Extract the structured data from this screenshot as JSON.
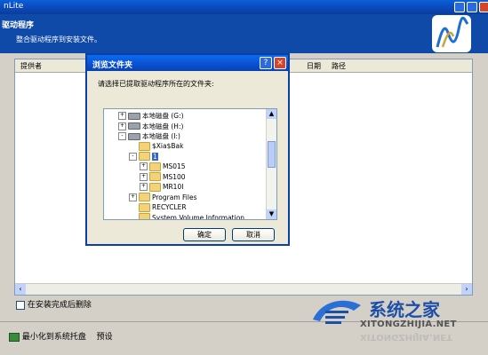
{
  "window": {
    "title": "nLite"
  },
  "header": {
    "title": "驱动程序",
    "subtitle": "整合驱动程序到安装文件。"
  },
  "list": {
    "columns": [
      "提供者",
      "日期",
      "路径"
    ]
  },
  "dialog": {
    "title": "浏览文件夹",
    "help_label": "?",
    "close_label": "×",
    "prompt": "请选择已提取驱动程序所在的文件夹:",
    "tree": [
      {
        "label": "本地磁盘 (G:)",
        "kind": "drive",
        "expander": "+",
        "selected": false
      },
      {
        "label": "本地磁盘 (H:)",
        "kind": "drive",
        "expander": "+",
        "selected": false
      },
      {
        "label": "本地磁盘 (I:)",
        "kind": "drive",
        "expander": "-",
        "selected": false
      },
      {
        "label": "$Xia$Bak",
        "kind": "folder",
        "expander": "",
        "selected": false
      },
      {
        "label": "1",
        "kind": "folder",
        "expander": "-",
        "selected": true
      },
      {
        "label": "MS015",
        "kind": "folder",
        "expander": "+",
        "selected": false
      },
      {
        "label": "MS100",
        "kind": "folder",
        "expander": "+",
        "selected": false
      },
      {
        "label": "MR10I",
        "kind": "folder",
        "expander": "+",
        "selected": false
      },
      {
        "label": "Program Files",
        "kind": "folder",
        "expander": "+",
        "selected": false
      },
      {
        "label": "RECYCLER",
        "kind": "folder",
        "expander": "",
        "selected": false
      },
      {
        "label": "System Volume Information",
        "kind": "folder",
        "expander": "",
        "selected": false
      }
    ],
    "ok_label": "确定",
    "cancel_label": "取消"
  },
  "options": {
    "delete_after_install_label": "在安装完成后删除",
    "delete_after_install_checked": false
  },
  "bottom": {
    "minimize_label": "最小化到系统托盘",
    "preset_label": "预设"
  },
  "watermark": {
    "title": "系统之家",
    "url": "XITONGZHIJIA.NET"
  },
  "colors": {
    "title_blue": "#0b48b8",
    "header_blue": "#0f4aa8",
    "selection": "#316ac5"
  }
}
